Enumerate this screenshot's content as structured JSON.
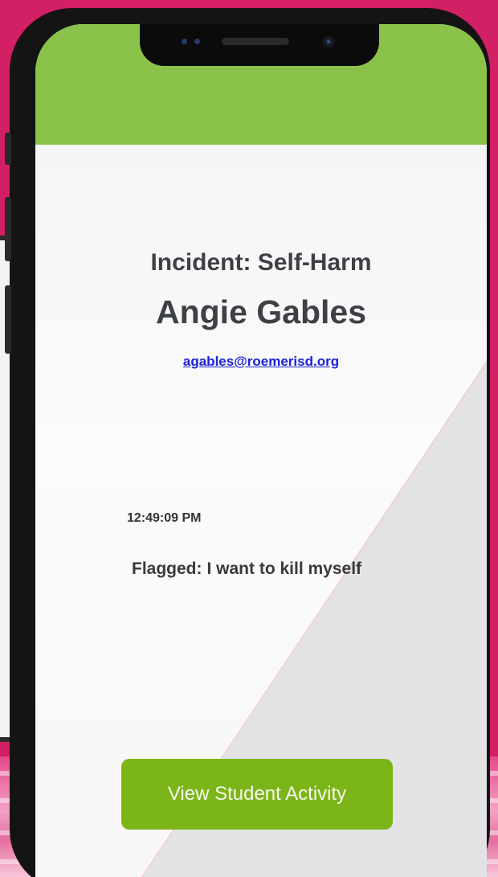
{
  "incident": {
    "title": "Incident: Self-Harm",
    "student_name": "Angie Gables",
    "email": "agables@roemerisd.org",
    "time": "12:49:09 PM",
    "flag_label": "Flagged:",
    "flag_text": "I want to kill myself"
  },
  "actions": {
    "view_activity_label": "View Student Activity"
  },
  "colors": {
    "header": "#8bc34a",
    "button": "#7cb518",
    "background": "#d31f63",
    "link": "#1a22d8"
  }
}
